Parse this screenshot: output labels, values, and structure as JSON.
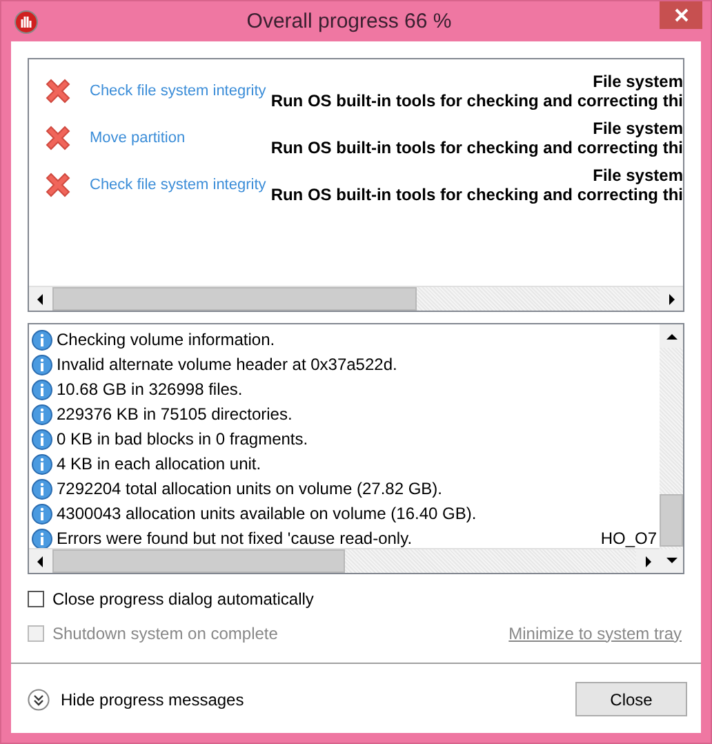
{
  "window": {
    "title": "Overall progress 66 %"
  },
  "operations": [
    {
      "kind": "failed",
      "name": "Check file system integrity",
      "detail_title": "File system",
      "detail_text": "Run OS built-in tools for checking and correcting thi"
    },
    {
      "kind": "failed",
      "name": "Move partition",
      "detail_title": "File system",
      "detail_text": "Run OS built-in tools for checking and correcting thi"
    },
    {
      "kind": "failed",
      "name": "Check file system integrity",
      "detail_title": "File system",
      "detail_text": "Run OS built-in tools for checking and correcting thi"
    }
  ],
  "log": [
    {
      "kind": "info",
      "text": "Checking volume information."
    },
    {
      "kind": "info",
      "text": "Invalid alternate volume header at 0x37a522d."
    },
    {
      "kind": "info",
      "text": "10.68 GB in 326998 files."
    },
    {
      "kind": "info",
      "text": "229376 KB in 75105 directories."
    },
    {
      "kind": "info",
      "text": "0 KB in bad blocks in 0 fragments."
    },
    {
      "kind": "info",
      "text": "4 KB in each allocation unit."
    },
    {
      "kind": "info",
      "text": "7292204 total allocation units on volume (27.82 GB)."
    },
    {
      "kind": "info",
      "text": "4300043 allocation units available on volume (16.40 GB)."
    },
    {
      "kind": "info",
      "text": "Errors were found but not fixed 'cause read-only.",
      "tag": "HO_O7"
    }
  ],
  "options": [
    {
      "label": "Close progress dialog automatically",
      "checked": false,
      "disabled": false
    },
    {
      "label": "Shutdown system on complete",
      "checked": false,
      "disabled": true
    }
  ],
  "tray_link": "Minimize to system tray",
  "toggle_messages": "Hide progress messages",
  "close_button": "Close"
}
